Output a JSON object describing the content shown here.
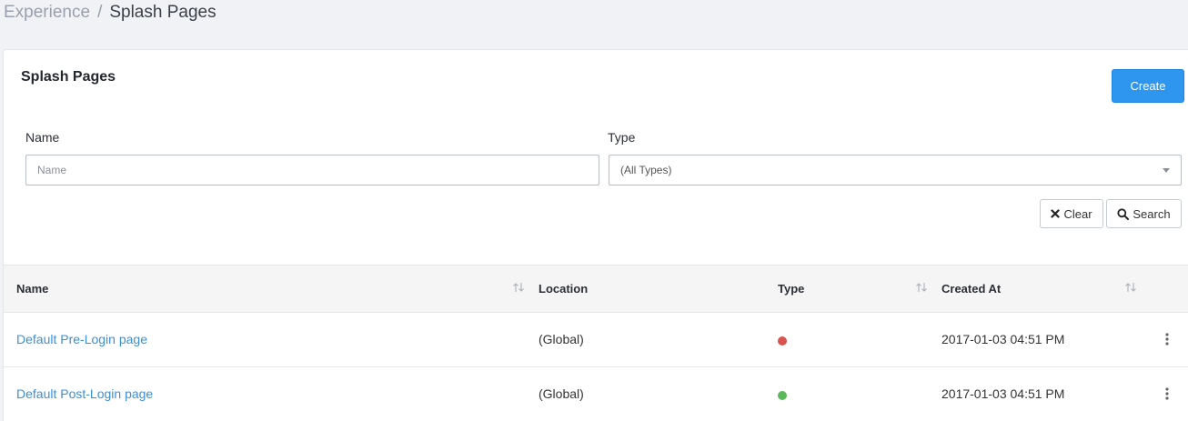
{
  "breadcrumb": {
    "parent": "Experience",
    "separator": "/",
    "current": "Splash Pages"
  },
  "panel": {
    "title": "Splash Pages",
    "create_label": "Create"
  },
  "filters": {
    "name_label": "Name",
    "name_placeholder": "Name",
    "type_label": "Type",
    "type_selected": "(All Types)",
    "clear_label": "Clear",
    "search_label": "Search"
  },
  "table": {
    "columns": [
      "Name",
      "Location",
      "Type",
      "Created At"
    ],
    "rows": [
      {
        "name": "Default Pre-Login page",
        "location": "(Global)",
        "type_status": "pre-login",
        "type_color": "#d9534f",
        "created_at": "2017-01-03 04:51 PM"
      },
      {
        "name": "Default Post-Login page",
        "location": "(Global)",
        "type_status": "post-login",
        "type_color": "#5cb85c",
        "created_at": "2017-01-03 04:51 PM"
      }
    ]
  },
  "colors": {
    "accent": "#2f96f0",
    "link": "#3a8fd9"
  }
}
